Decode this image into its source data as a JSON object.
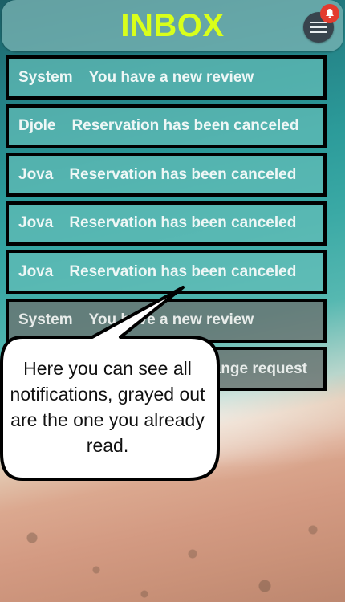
{
  "header": {
    "title": "INBOX",
    "menu_icon": "hamburger-menu-icon",
    "badge_icon": "bell-icon",
    "title_color": "#d9ff1a",
    "badge_color": "#e33b2e"
  },
  "notifications": [
    {
      "sender": "System",
      "message": "You have a new review",
      "read": false
    },
    {
      "sender": "Djole",
      "message": "Reservation has been canceled",
      "read": false
    },
    {
      "sender": "Jova",
      "message": "Reservation has been canceled",
      "read": false
    },
    {
      "sender": "Jova",
      "message": "Reservation has been canceled",
      "read": false
    },
    {
      "sender": "Jova",
      "message": "Reservation has been canceled",
      "read": false
    },
    {
      "sender": "System",
      "message": "You have a new review",
      "read": true
    },
    {
      "sender": "",
      "message": "ange request",
      "read": true
    }
  ],
  "tooltip": {
    "text": "Here you can see all notifications, grayed out are the one you already read."
  }
}
